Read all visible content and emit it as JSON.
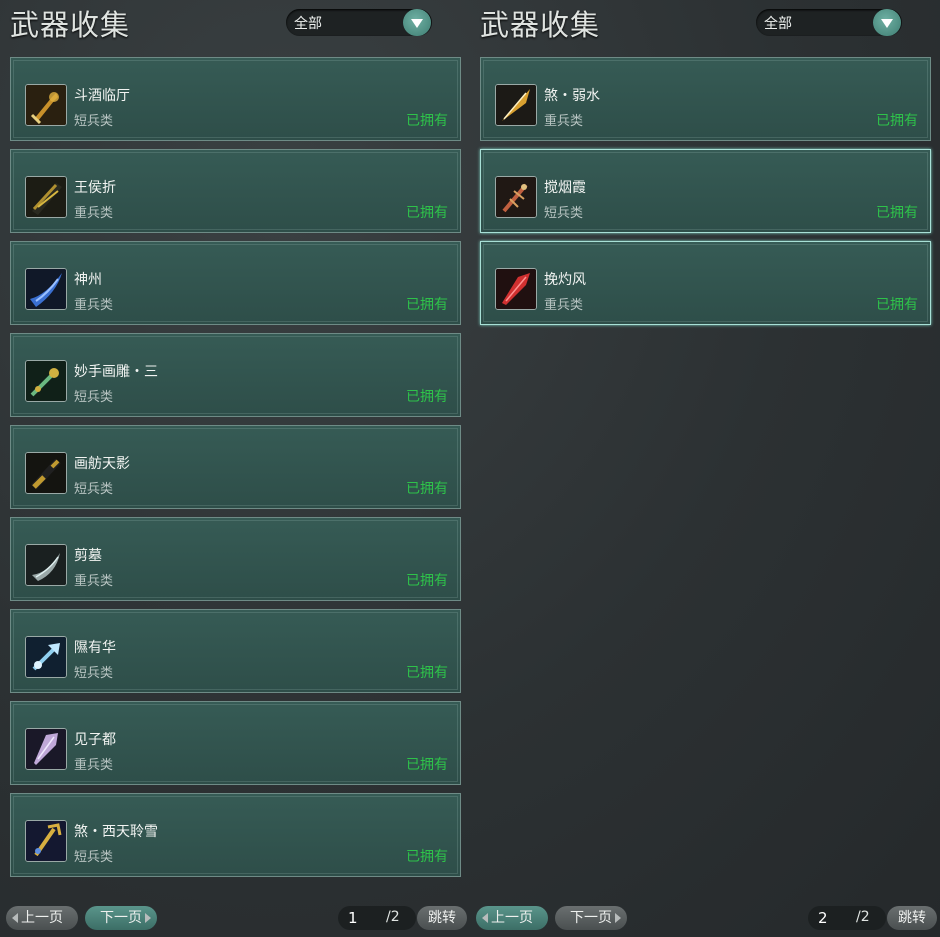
{
  "panels": [
    {
      "title": "武器收集",
      "filter": "全部",
      "items": [
        {
          "name": "斗酒临厅",
          "type": "短兵类",
          "status": "已拥有",
          "icon": "golden-dagger-icon",
          "color": "#c8902a"
        },
        {
          "name": "王侯折",
          "type": "重兵类",
          "status": "已拥有",
          "icon": "dark-gold-blade-icon",
          "color": "#b09030"
        },
        {
          "name": "神州",
          "type": "重兵类",
          "status": "已拥有",
          "icon": "blue-blade-icon",
          "color": "#3a6fd0"
        },
        {
          "name": "妙手画雕・三",
          "type": "短兵类",
          "status": "已拥有",
          "icon": "jade-dagger-icon",
          "color": "#6ab880"
        },
        {
          "name": "画舫天影",
          "type": "短兵类",
          "status": "已拥有",
          "icon": "gold-tipped-dagger-icon",
          "color": "#c09a30"
        },
        {
          "name": "剪墓",
          "type": "重兵类",
          "status": "已拥有",
          "icon": "silver-blade-icon",
          "color": "#9aa8a8"
        },
        {
          "name": "隰有华",
          "type": "短兵类",
          "status": "已拥有",
          "icon": "crystal-dagger-icon",
          "color": "#90d0f0"
        },
        {
          "name": "见子都",
          "type": "重兵类",
          "status": "已拥有",
          "icon": "violet-blade-icon",
          "color": "#c0a8d8"
        },
        {
          "name": "煞・西天聆雪",
          "type": "短兵类",
          "status": "已拥有",
          "icon": "trident-dagger-icon",
          "color": "#d8b040"
        }
      ],
      "pager": {
        "prev": "上一页",
        "next": "下一页",
        "current": "1",
        "total": "/2",
        "jump": "跳转"
      }
    },
    {
      "title": "武器收集",
      "filter": "全部",
      "items": [
        {
          "name": "煞・弱水",
          "type": "重兵类",
          "status": "已拥有",
          "icon": "golden-spear-icon",
          "color": "#d8a030"
        },
        {
          "name": "搅烟霞",
          "type": "短兵类",
          "status": "已拥有",
          "icon": "thorned-dagger-icon",
          "color": "#c06040"
        },
        {
          "name": "挽灼风",
          "type": "重兵类",
          "status": "已拥有",
          "icon": "crimson-blade-icon",
          "color": "#d03030"
        }
      ],
      "pager": {
        "prev": "上一页",
        "next": "下一页",
        "current": "2",
        "total": "/2",
        "jump": "跳转"
      }
    }
  ]
}
